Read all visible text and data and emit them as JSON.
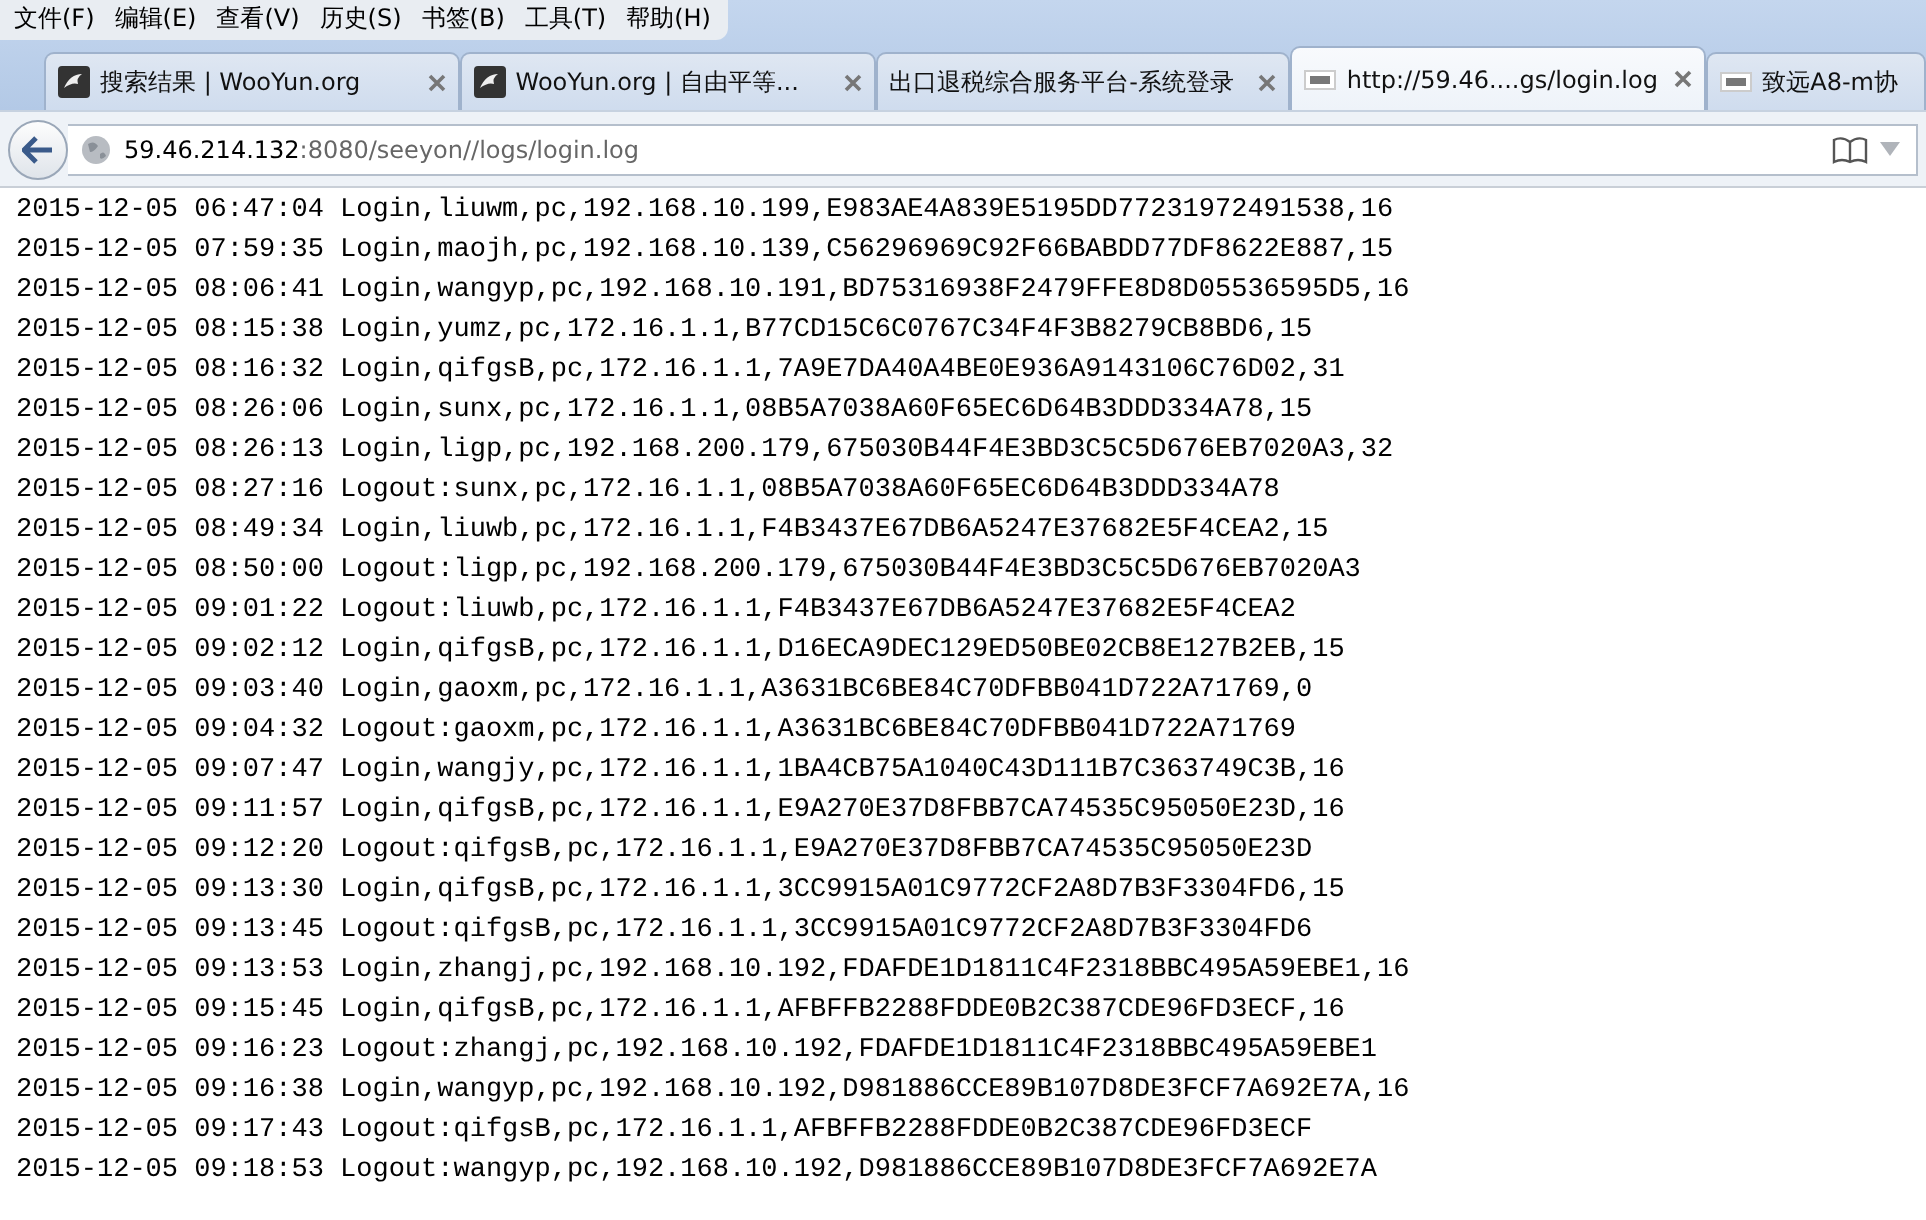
{
  "menu": [
    "文件(F)",
    "编辑(E)",
    "查看(V)",
    "历史(S)",
    "书签(B)",
    "工具(T)",
    "帮助(H)"
  ],
  "tabs": [
    {
      "title": "搜索结果 | WooYun.org",
      "kind": "bird",
      "selected": false
    },
    {
      "title": "WooYun.org | 自由平等...",
      "kind": "bird",
      "selected": false
    },
    {
      "title": "出口退税综合服务平台-系统登录",
      "kind": "plain",
      "selected": false
    },
    {
      "title": "http://59.46....gs/login.log",
      "kind": "tile",
      "selected": true
    },
    {
      "title": "致远A8-m协",
      "kind": "tile",
      "selected": false
    }
  ],
  "address": {
    "host": "59.46.214.132",
    "rest": ":8080/seeyon//logs/login.log"
  },
  "log_lines": [
    "2015-12-05 06:47:04 Login,liuwm,pc,192.168.10.199,E983AE4A839E5195DD77231972491538,16",
    "2015-12-05 07:59:35 Login,maojh,pc,192.168.10.139,C56296969C92F66BABDD77DF8622E887,15",
    "2015-12-05 08:06:41 Login,wangyp,pc,192.168.10.191,BD75316938F2479FFE8D8D05536595D5,16",
    "2015-12-05 08:15:38 Login,yumz,pc,172.16.1.1,B77CD15C6C0767C34F4F3B8279CB8BD6,15",
    "2015-12-05 08:16:32 Login,qifgsB,pc,172.16.1.1,7A9E7DA40A4BE0E936A9143106C76D02,31",
    "2015-12-05 08:26:06 Login,sunx,pc,172.16.1.1,08B5A7038A60F65EC6D64B3DDD334A78,15",
    "2015-12-05 08:26:13 Login,ligp,pc,192.168.200.179,675030B44F4E3BD3C5C5D676EB7020A3,32",
    "2015-12-05 08:27:16 Logout:sunx,pc,172.16.1.1,08B5A7038A60F65EC6D64B3DDD334A78",
    "2015-12-05 08:49:34 Login,liuwb,pc,172.16.1.1,F4B3437E67DB6A5247E37682E5F4CEA2,15",
    "2015-12-05 08:50:00 Logout:ligp,pc,192.168.200.179,675030B44F4E3BD3C5C5D676EB7020A3",
    "2015-12-05 09:01:22 Logout:liuwb,pc,172.16.1.1,F4B3437E67DB6A5247E37682E5F4CEA2",
    "2015-12-05 09:02:12 Login,qifgsB,pc,172.16.1.1,D16ECA9DEC129ED50BE02CB8E127B2EB,15",
    "2015-12-05 09:03:40 Login,gaoxm,pc,172.16.1.1,A3631BC6BE84C70DFBB041D722A71769,0",
    "2015-12-05 09:04:32 Logout:gaoxm,pc,172.16.1.1,A3631BC6BE84C70DFBB041D722A71769",
    "2015-12-05 09:07:47 Login,wangjy,pc,172.16.1.1,1BA4CB75A1040C43D111B7C363749C3B,16",
    "2015-12-05 09:11:57 Login,qifgsB,pc,172.16.1.1,E9A270E37D8FBB7CA74535C95050E23D,16",
    "2015-12-05 09:12:20 Logout:qifgsB,pc,172.16.1.1,E9A270E37D8FBB7CA74535C95050E23D",
    "2015-12-05 09:13:30 Login,qifgsB,pc,172.16.1.1,3CC9915A01C9772CF2A8D7B3F3304FD6,15",
    "2015-12-05 09:13:45 Logout:qifgsB,pc,172.16.1.1,3CC9915A01C9772CF2A8D7B3F3304FD6",
    "2015-12-05 09:13:53 Login,zhangj,pc,192.168.10.192,FDAFDE1D1811C4F2318BBC495A59EBE1,16",
    "2015-12-05 09:15:45 Login,qifgsB,pc,172.16.1.1,AFBFFB2288FDDE0B2C387CDE96FD3ECF,16",
    "2015-12-05 09:16:23 Logout:zhangj,pc,192.168.10.192,FDAFDE1D1811C4F2318BBC495A59EBE1",
    "2015-12-05 09:16:38 Login,wangyp,pc,192.168.10.192,D981886CCE89B107D8DE3FCF7A692E7A,16",
    "2015-12-05 09:17:43 Logout:qifgsB,pc,172.16.1.1,AFBFFB2288FDDE0B2C387CDE96FD3ECF",
    "2015-12-05 09:18:53 Logout:wangyp,pc,192.168.10.192,D981886CCE89B107D8DE3FCF7A692E7A"
  ]
}
